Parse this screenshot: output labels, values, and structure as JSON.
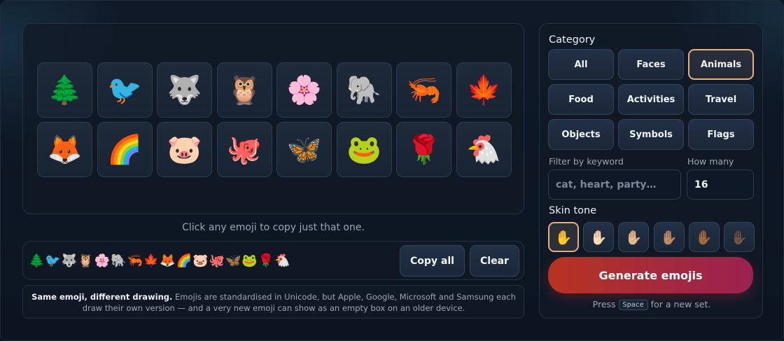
{
  "grid": {
    "emojis": [
      "🌲",
      "🐦",
      "🐺",
      "🦉",
      "🌸",
      "🐘",
      "🦐",
      "🍁",
      "🦊",
      "🌈",
      "🐷",
      "🐙",
      "🦋",
      "🐸",
      "🌹",
      "🐔"
    ]
  },
  "hint_text": "Click any emoji to copy just that one.",
  "strip": {
    "text": "🌲🐦🐺🦉🌸🐘🦐🍁🦊🌈🐷🐙🦋🐸🌹🐔",
    "copy_all_label": "Copy all",
    "clear_label": "Clear"
  },
  "note": {
    "bold": "Same emoji, different drawing.",
    "text": " Emojis are standardised in Unicode, but Apple, Google, Microsoft and Samsung each draw their own version — and a very new emoji can show as an empty box on an older device."
  },
  "sidebar": {
    "category_label": "Category",
    "categories": [
      "All",
      "Faces",
      "Animals",
      "Food",
      "Activities",
      "Travel",
      "Objects",
      "Symbols",
      "Flags"
    ],
    "selected_category": "Animals",
    "filter_label": "Filter by keyword",
    "filter_placeholder": "cat, heart, party…",
    "filter_value": "",
    "count_label": "How many",
    "count_value": "16",
    "skin_label": "Skin tone",
    "skin_tones": [
      "✋",
      "✋🏻",
      "✋🏼",
      "✋🏽",
      "✋🏾",
      "✋🏿"
    ],
    "selected_skin_index": 0,
    "generate_label": "Generate emojis",
    "press_prefix": "Press",
    "press_key": "Space",
    "press_suffix": "for a new set."
  },
  "colors": {
    "accent_border": "#e8b07a",
    "generate_gradient_start": "#b8331f",
    "generate_gradient_end": "#9a2150",
    "background": "#0b1220"
  }
}
